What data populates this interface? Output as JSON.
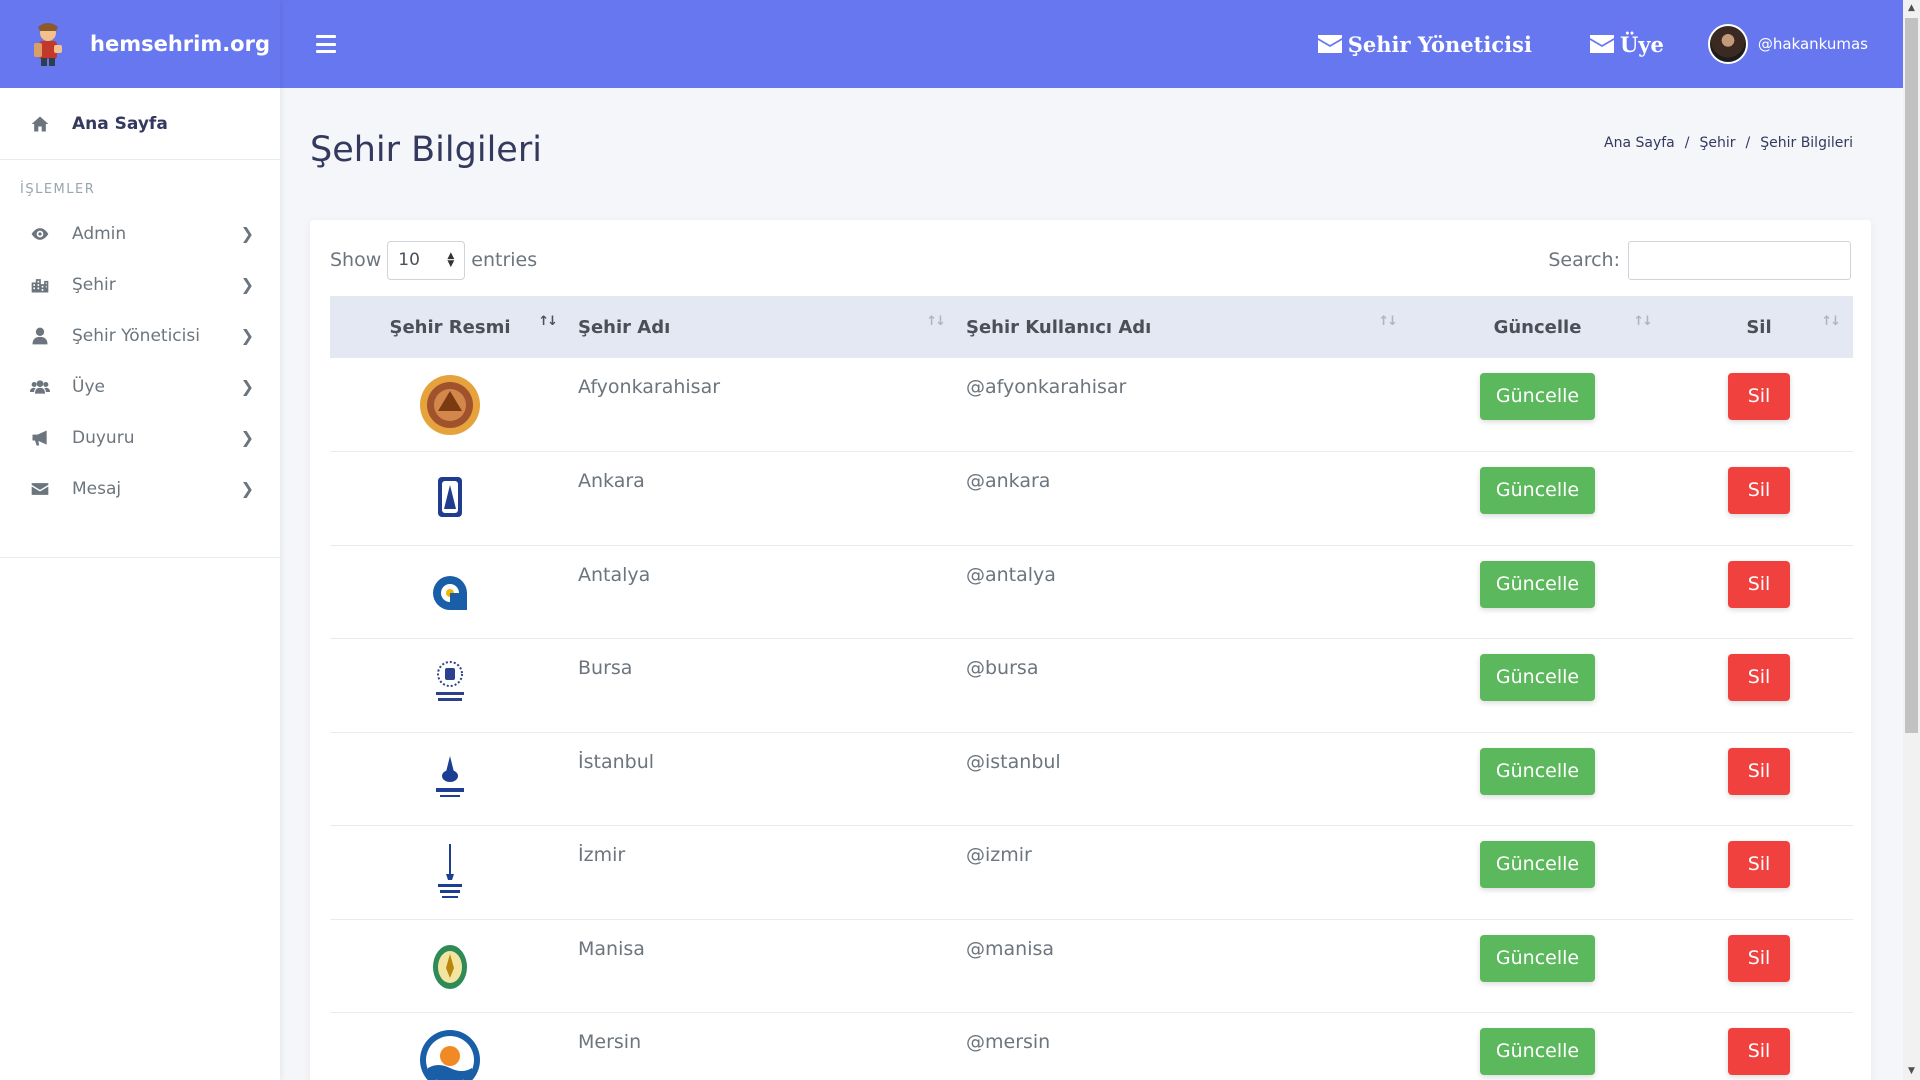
{
  "brand": {
    "name": "hemsehrim.org"
  },
  "sidebar": {
    "home": "Ana Sayfa",
    "section": "İŞLEMLER",
    "items": [
      {
        "label": "Admin",
        "icon": "eye-icon"
      },
      {
        "label": "Şehir",
        "icon": "city-icon"
      },
      {
        "label": "Şehir Yöneticisi",
        "icon": "user-icon"
      },
      {
        "label": "Üye",
        "icon": "users-icon"
      },
      {
        "label": "Duyuru",
        "icon": "bullhorn-icon"
      },
      {
        "label": "Mesaj",
        "icon": "envelope-icon"
      }
    ]
  },
  "topbar": {
    "links": [
      "Şehir Yöneticisi",
      "Üye"
    ],
    "username": "@hakankumas"
  },
  "page": {
    "title": "Şehir Bilgileri",
    "breadcrumb": [
      "Ana Sayfa",
      "Şehir",
      "Şehir Bilgileri"
    ]
  },
  "table": {
    "show_label": "Show",
    "entries_value": "10",
    "entries_label": "entries",
    "search_label": "Search:",
    "columns": [
      "Şehir Resmi",
      "Şehir Adı",
      "Şehir Kullanıcı Adı",
      "Güncelle",
      "Sil"
    ],
    "update_label": "Güncelle",
    "delete_label": "Sil",
    "rows": [
      {
        "name": "Afyonkarahisar",
        "username": "@afyonkarahisar",
        "logo": "afyonkarahisar-logo"
      },
      {
        "name": "Ankara",
        "username": "@ankara",
        "logo": "ankara-logo"
      },
      {
        "name": "Antalya",
        "username": "@antalya",
        "logo": "antalya-logo"
      },
      {
        "name": "Bursa",
        "username": "@bursa",
        "logo": "bursa-logo"
      },
      {
        "name": "İstanbul",
        "username": "@istanbul",
        "logo": "istanbul-logo"
      },
      {
        "name": "İzmir",
        "username": "@izmir",
        "logo": "izmir-logo"
      },
      {
        "name": "Manisa",
        "username": "@manisa",
        "logo": "manisa-logo"
      },
      {
        "name": "Mersin",
        "username": "@mersin",
        "logo": "mersin-logo"
      }
    ]
  },
  "colors": {
    "primary": "#6777ef",
    "success": "#5cb85c",
    "danger": "#f1413f"
  }
}
